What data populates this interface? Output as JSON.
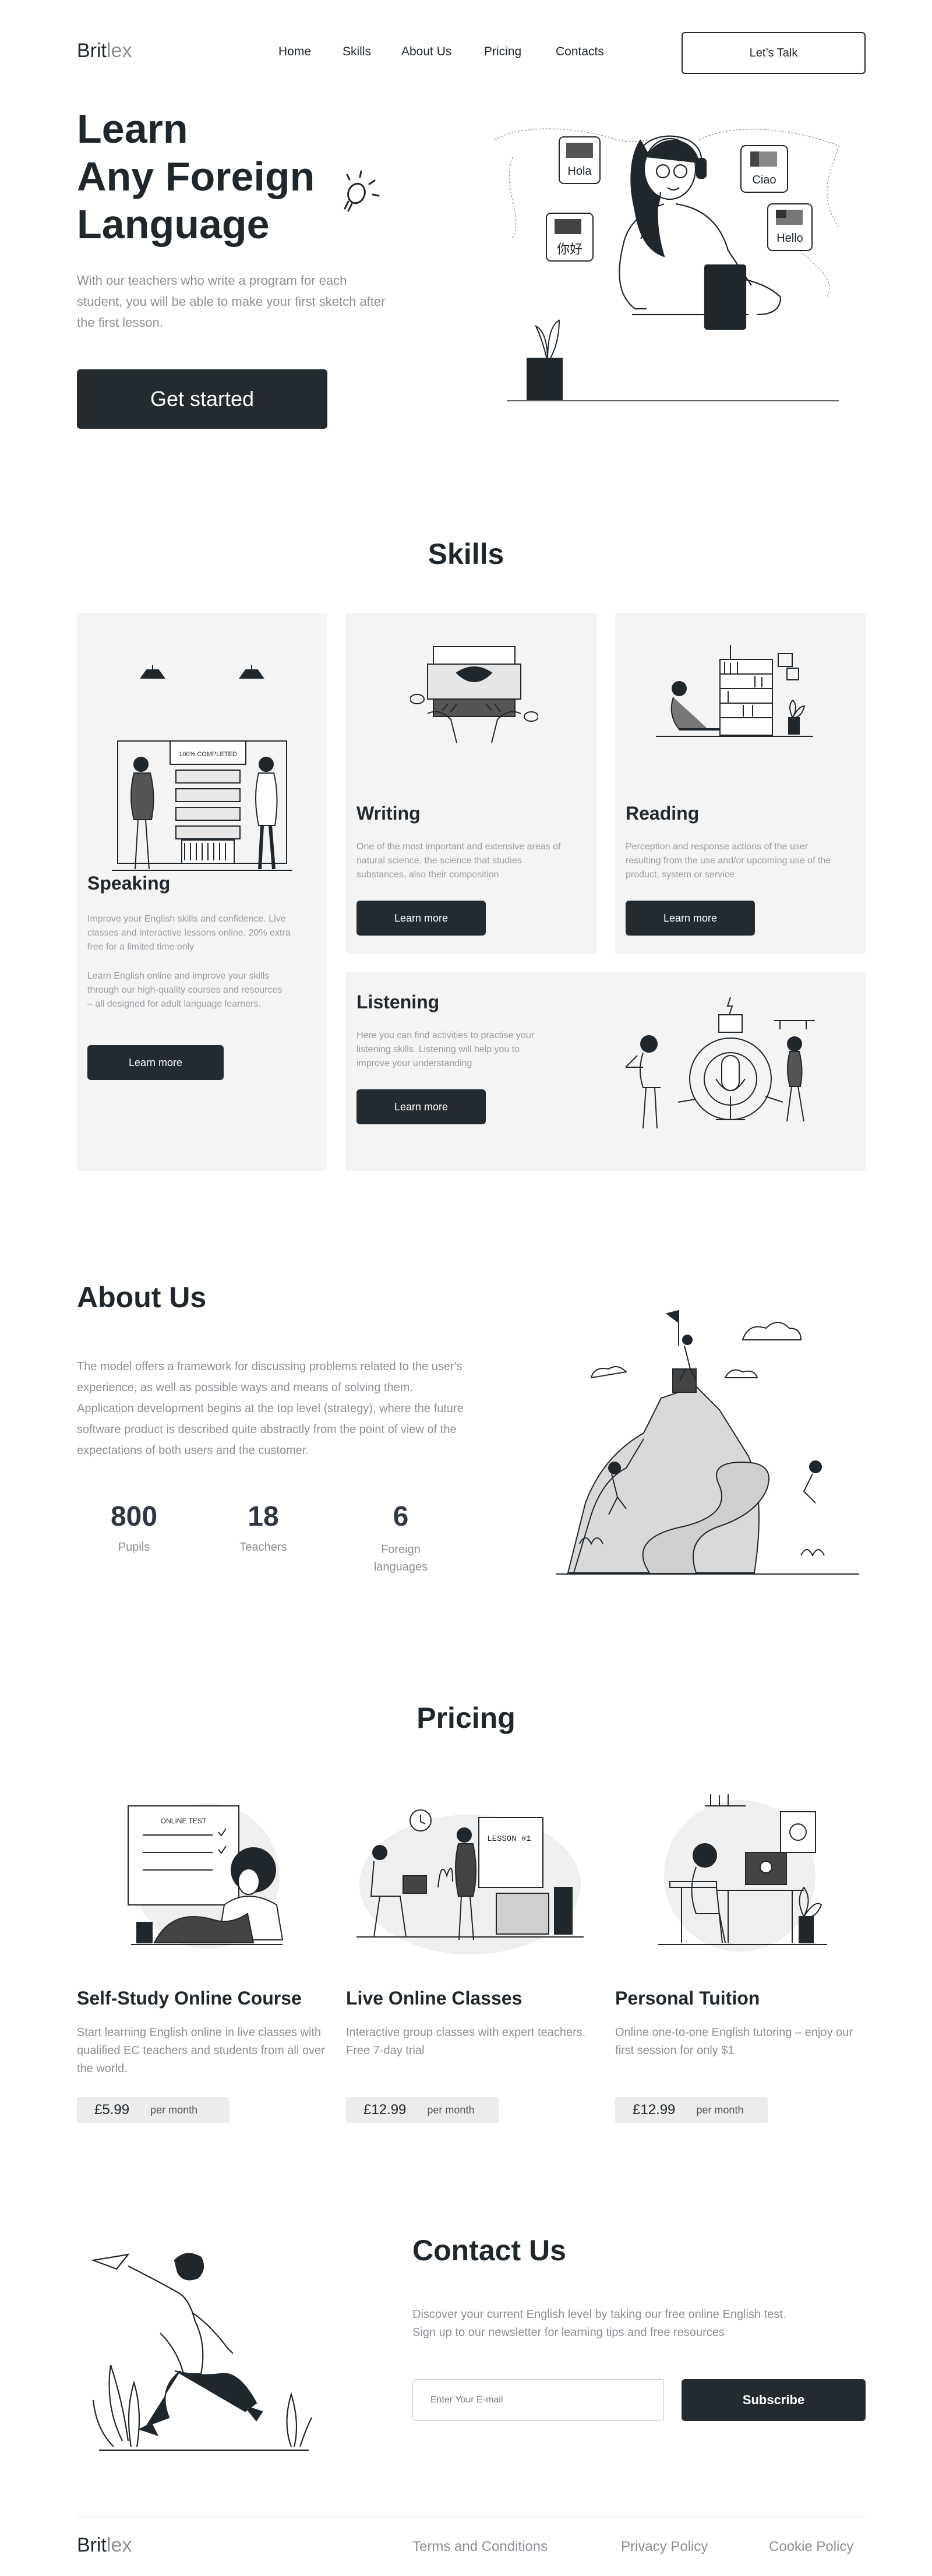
{
  "brand": {
    "part1": "Brit",
    "part2": "lex"
  },
  "nav": {
    "items": [
      "Home",
      "Skills",
      "About Us",
      "Pricing",
      "Contacts"
    ],
    "cta": "Let’s Talk"
  },
  "hero": {
    "title_lines": [
      "Learn",
      "Any Foreign",
      "Language"
    ],
    "description": "With our teachers who write a program for each student, you will be able to make your first sketch after the first lesson.",
    "cta": "Get started",
    "bubbles": [
      "Hola",
      "Ciao",
      "你好",
      "Hello"
    ]
  },
  "skills": {
    "title": "Skills",
    "speaking": {
      "heading": "Speaking",
      "p1": "Improve your English skills and confidence. Live classes and interactive lessons online. 20% extra free for a limited time only",
      "p2": "Learn English online and improve your skills through our high-quality courses and resources – all designed for adult language learners.",
      "button": "Learn more",
      "illustration_label": "100% COMPLETED"
    },
    "writing": {
      "heading": "Writing",
      "text": "One of the most important and extensive areas of natural science, the science that studies substances, also their composition",
      "button": "Learn more"
    },
    "reading": {
      "heading": "Reading",
      "text": "Perception and response actions of the user resulting from the use and/or upcoming use of the product, system or service",
      "button": "Learn more"
    },
    "listening": {
      "heading": "Listening",
      "text": "Here you can find activities to practise your listening skills. Listening will help you to improve your understanding",
      "button": "Learn more"
    }
  },
  "about": {
    "title": "About Us",
    "text": "The model offers a framework for discussing problems related to the user's experience, as well as possible ways and means of solving them. Application development begins at the top level (strategy), where the future software product is described quite abstractly from the point of view of the expectations of both users and the customer.",
    "stats": [
      {
        "value": "800",
        "label": "Pupils"
      },
      {
        "value": "18",
        "label": "Teachers"
      },
      {
        "value": "6",
        "label": "Foreign languages"
      }
    ]
  },
  "pricing": {
    "title": "Pricing",
    "plans": [
      {
        "title": "Self-Study Online Course",
        "desc": "Start learning English online in live classes with qualified EC teachers and students from all over the world.",
        "price": "£5.99",
        "per": "per month",
        "illustration_label": "ONLINE TEST"
      },
      {
        "title": "Live Online Classes",
        "desc": "Interactive group classes with expert teachers. Free 7-day trial",
        "price": "£12.99",
        "per": "per month",
        "illustration_label": "LESSON #1"
      },
      {
        "title": "Personal Tuition",
        "desc": "Online one-to-one English tutoring – enjoy our first session for only $1",
        "price": "£12.99",
        "per": "per month"
      }
    ]
  },
  "contact": {
    "title": "Contact Us",
    "text": "Discover your current English level by taking our free online English test. Sign up to our newsletter for learning tips and free resources",
    "email_placeholder": "Enter Your E-mail",
    "subscribe": "Subscribe"
  },
  "footer": {
    "links": [
      "Terms and Conditions",
      "Privacy Policy",
      "Cookie Policy"
    ]
  },
  "colors": {
    "dark": "#232b31",
    "card_bg": "#f4f4f4",
    "muted_text": "#8c8f98"
  },
  "icons": [
    "lightbulb-icon"
  ]
}
